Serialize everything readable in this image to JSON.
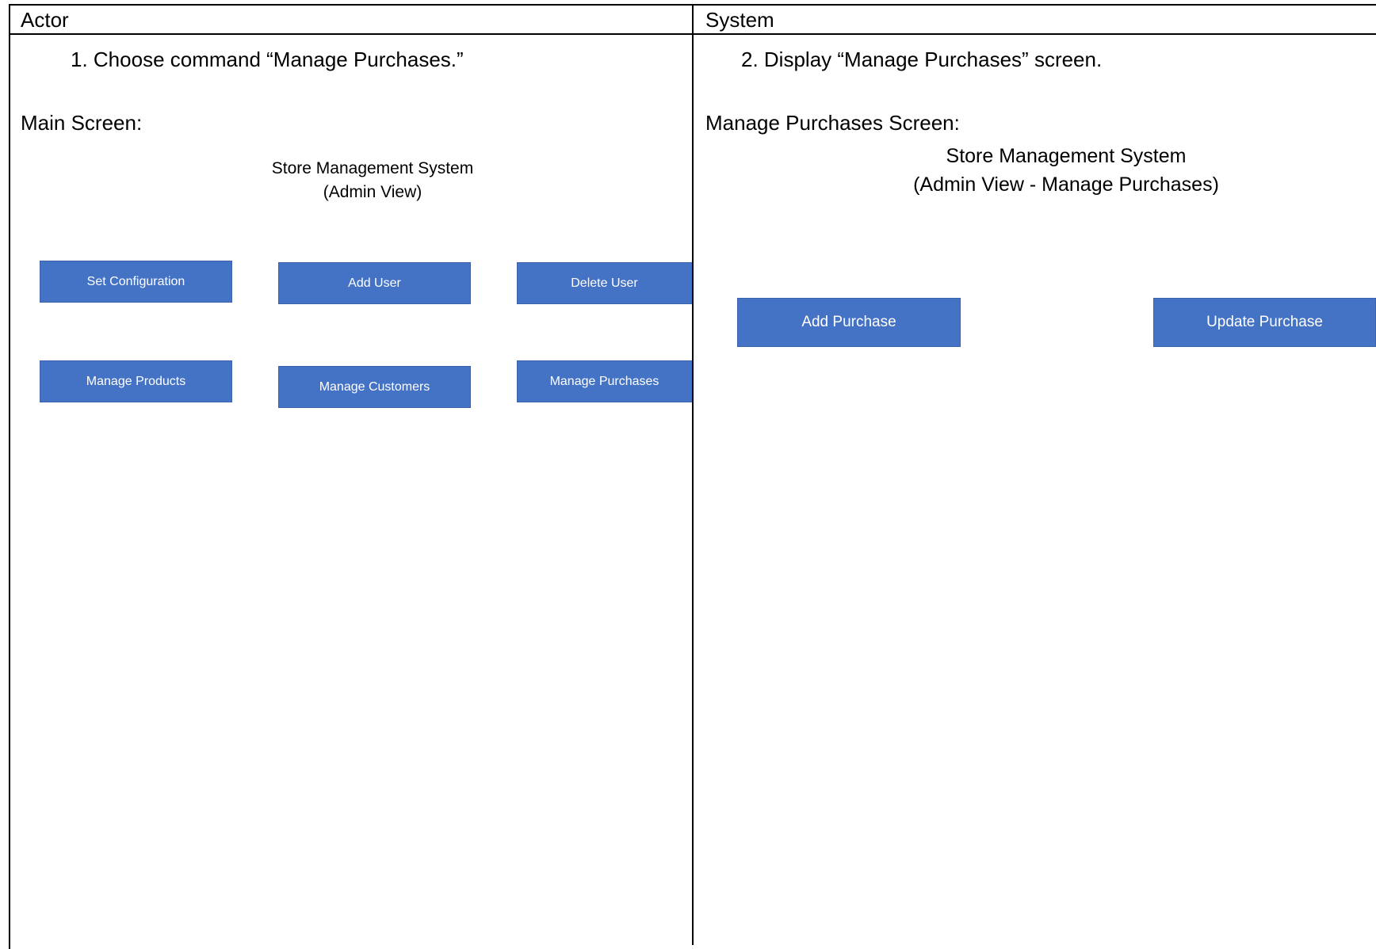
{
  "table": {
    "actor_header": "Actor",
    "system_header": "System"
  },
  "actor": {
    "step": "1.  Choose command “Manage Purchases.”",
    "screen_label": "Main Screen:",
    "screen": {
      "title_line1": "Store Management System",
      "title_line2": "(Admin View)",
      "buttons": [
        "Set Configuration",
        "Add User",
        "Delete User",
        "Manage Products",
        "Manage Customers",
        "Manage Purchases"
      ]
    }
  },
  "system": {
    "step": "2.  Display “Manage Purchases” screen.",
    "screen_label": "Manage Purchases Screen:",
    "screen": {
      "title_line1": "Store Management System",
      "title_line2": "(Admin View - Manage Purchases)",
      "buttons": [
        "Add Purchase",
        "Update Purchase"
      ]
    }
  },
  "colors": {
    "button_fill": "#4472c4",
    "button_text": "#ffffff",
    "grid_lines": "#000000"
  }
}
